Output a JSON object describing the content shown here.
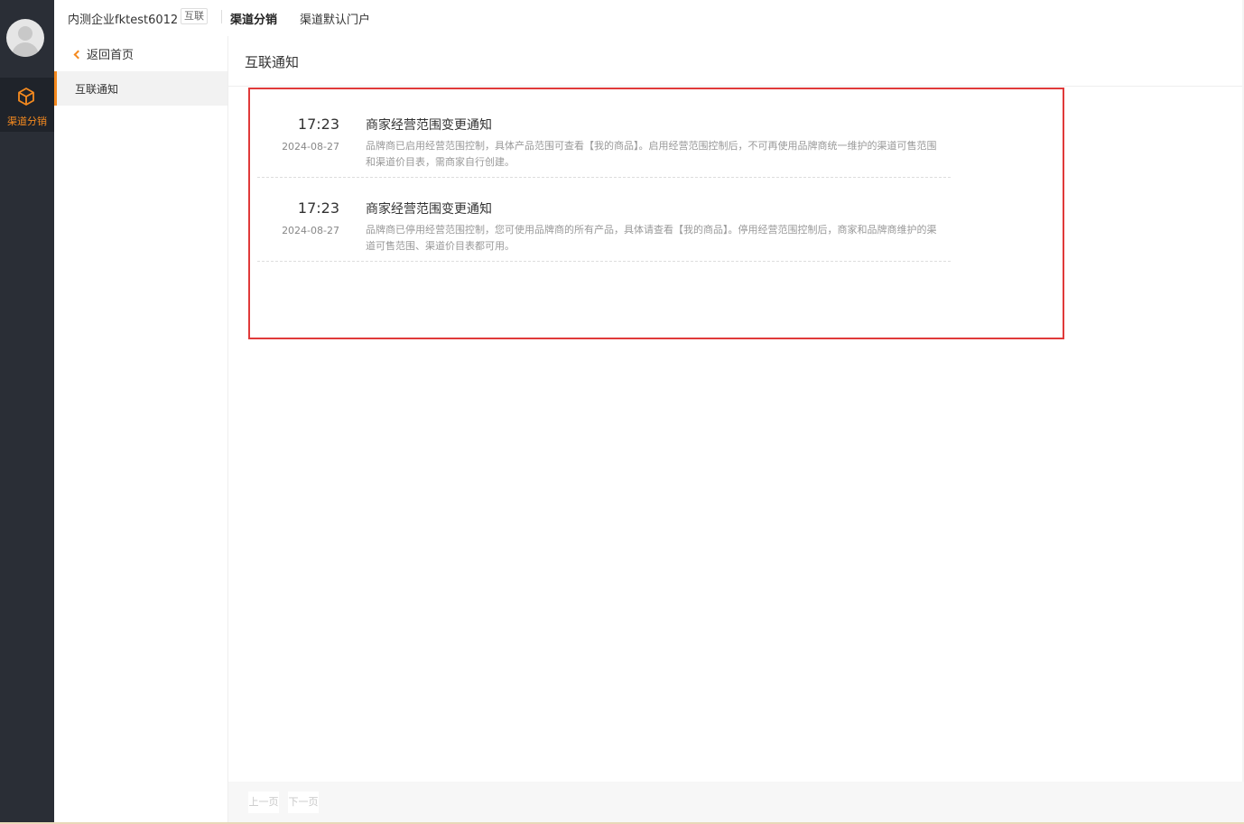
{
  "sidebar": {
    "nav_item_label": "渠道分销"
  },
  "topbar": {
    "company_name": "内测企业fktest6012",
    "badge": "互联",
    "tabs": [
      "渠道分销",
      "渠道默认门户"
    ]
  },
  "subsidebar": {
    "back_label": "返回首页",
    "items": [
      {
        "label": "互联通知"
      }
    ]
  },
  "main": {
    "title": "互联通知",
    "notices": [
      {
        "time": "17:23",
        "date": "2024-08-27",
        "title": "商家经营范围变更通知",
        "body": "品牌商已启用经营范围控制，具体产品范围可查看【我的商品】。启用经营范围控制后，不可再使用品牌商统一维护的渠道可售范围和渠道价目表，需商家自行创建。"
      },
      {
        "time": "17:23",
        "date": "2024-08-27",
        "title": "商家经营范围变更通知",
        "body": "品牌商已停用经营范围控制，您可使用品牌商的所有产品，具体请查看【我的商品】。停用经营范围控制后，商家和品牌商维护的渠道可售范围、渠道价目表都可用。"
      }
    ]
  },
  "pagination": {
    "prev": "上一页",
    "next": "下一页"
  },
  "colors": {
    "accent": "#f58a1f",
    "highlight_border": "#e03a3a",
    "nav_bg": "#2a2e36"
  }
}
